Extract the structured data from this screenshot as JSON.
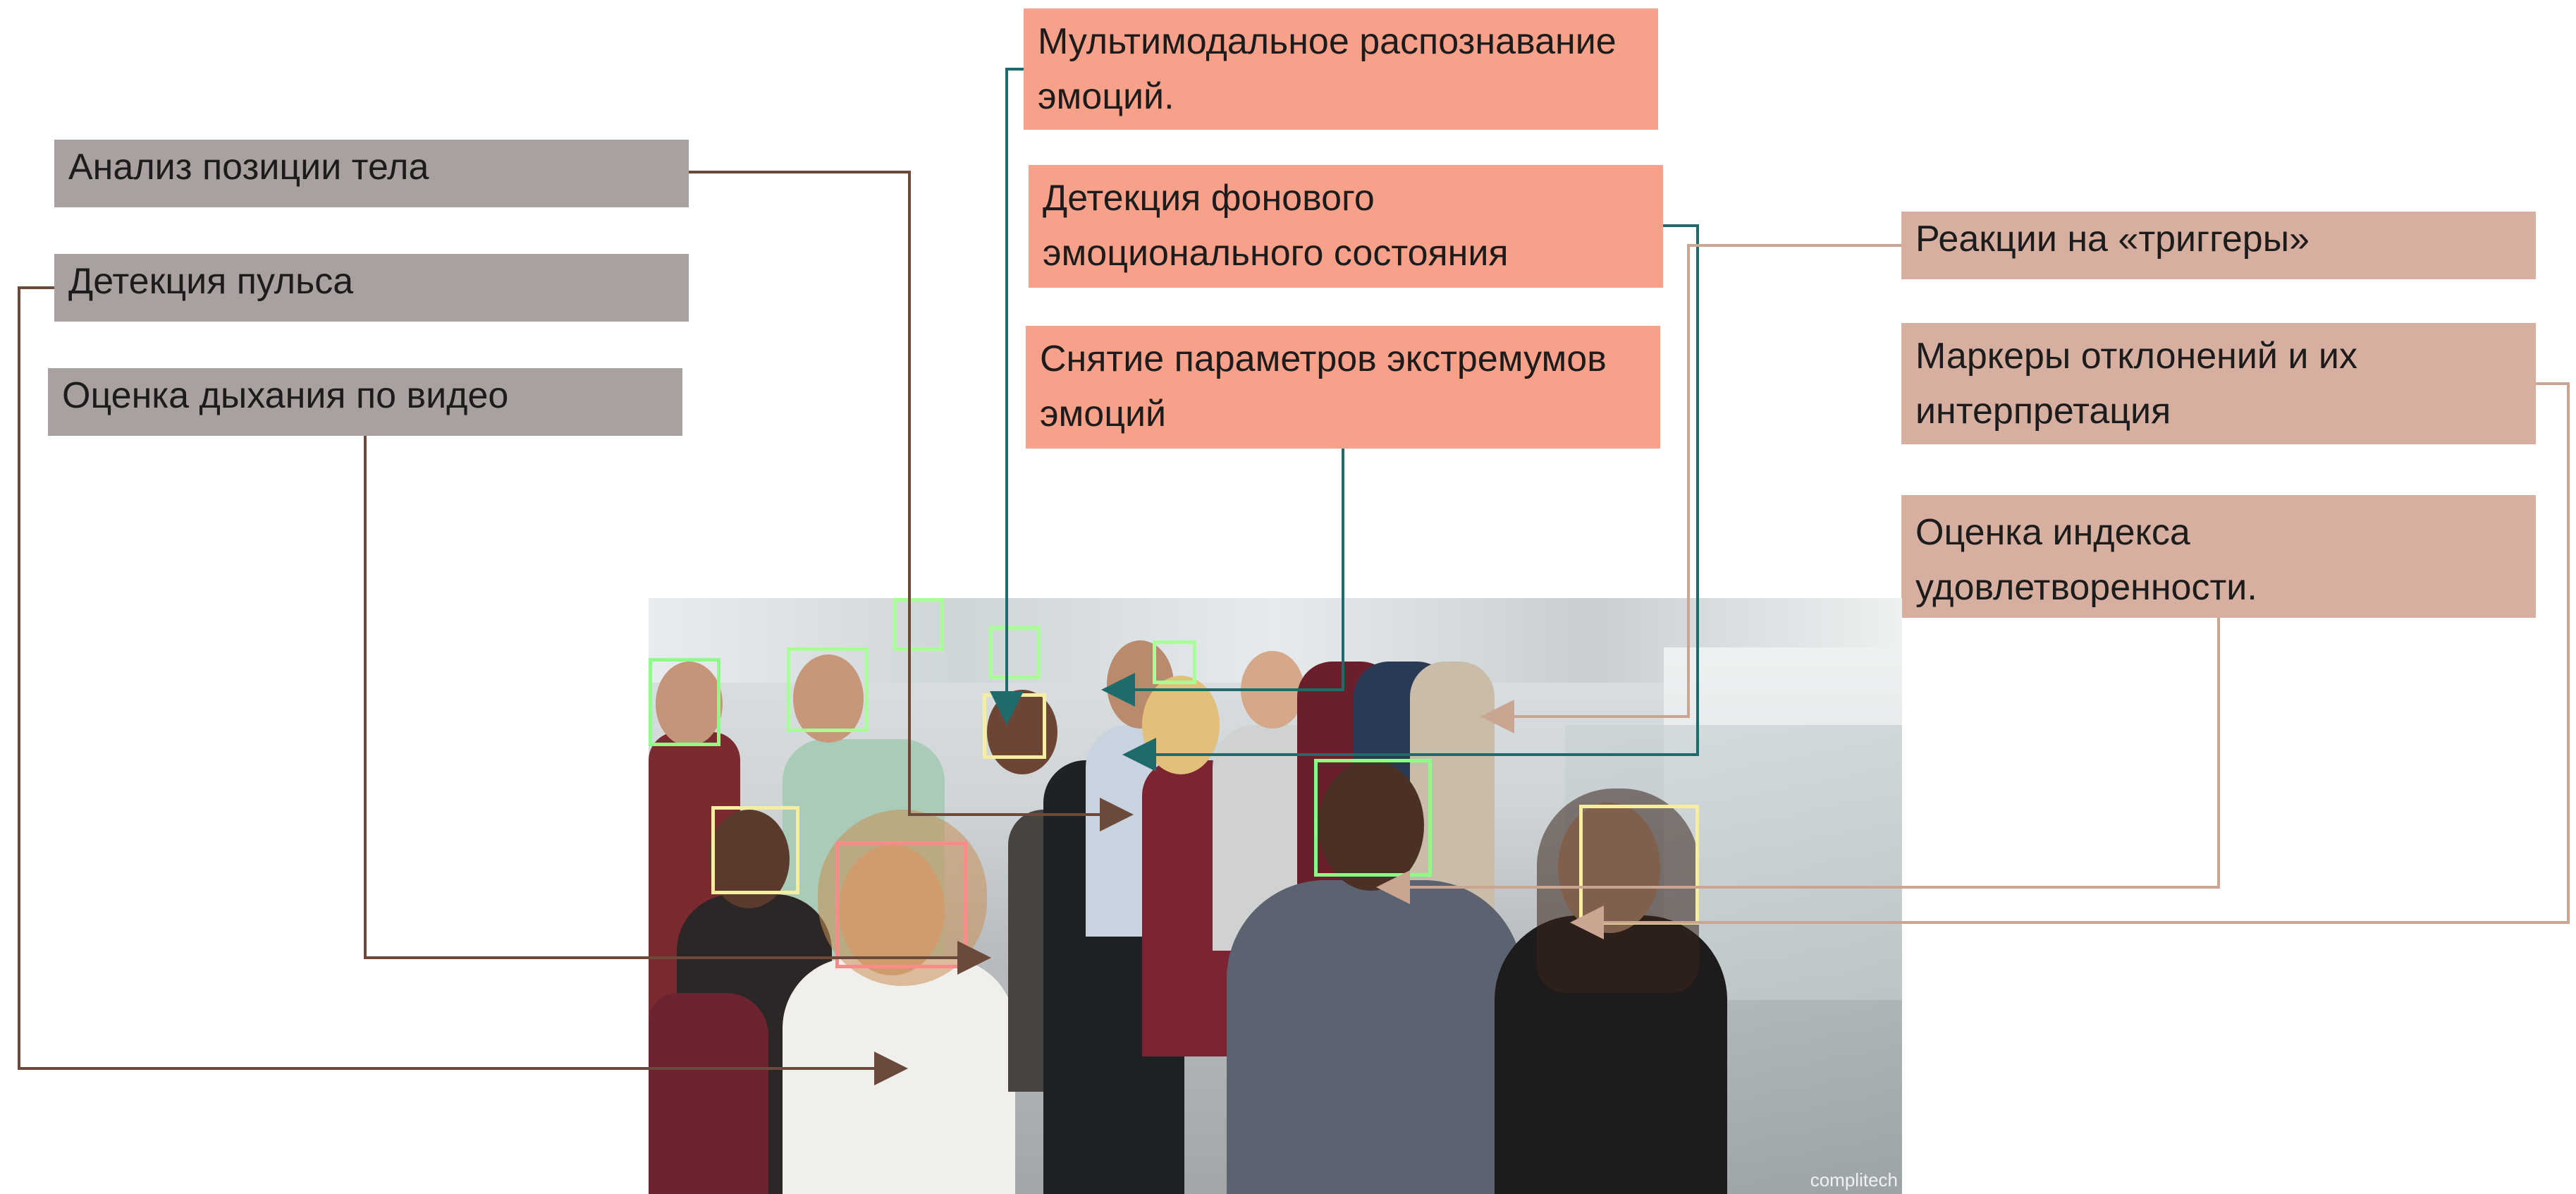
{
  "labels": {
    "body_position": "Анализ позиции тела",
    "pulse": "Детекция пульса",
    "breathing": "Оценка дыхания по видео",
    "multimodal": "Мультимодальное распознавание эмоций.",
    "background_state": "Детекция фонового эмоционального состояния",
    "extremes": "Снятие параметров экстремумов эмоций",
    "triggers": "Реакции на «триггеры»",
    "deviation_markers": "Маркеры отклонений и их интерпретация",
    "satisfaction_index": "Оценка индекса удовлетворенности."
  },
  "photo": {
    "watermark": "complitech"
  },
  "colors": {
    "grey_box": "#a9a19f",
    "salmon_box": "#f8a18a",
    "tan_box": "#d7afa0",
    "brown_line": "#6b4a3c",
    "teal_line": "#1f6b6b",
    "tan_line": "#c9a592"
  }
}
